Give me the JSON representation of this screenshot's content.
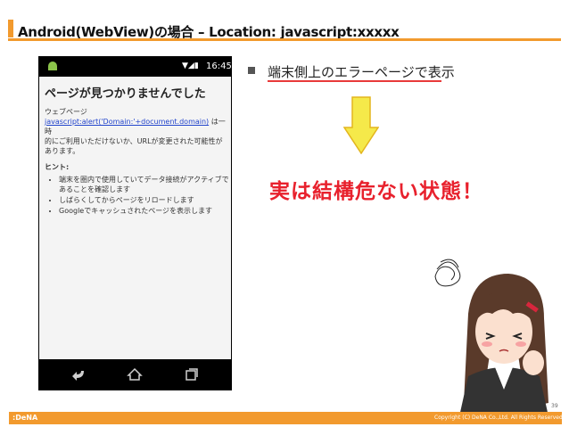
{
  "slide": {
    "title": "Android(WebView)の場合 – Location: javascript:xxxxx",
    "page_number": "39",
    "footer_logo": ":DeNA",
    "copyright": "Copyright (C) DeNA Co.,Ltd. All Rights Reserved."
  },
  "phone": {
    "status_time": "16:45",
    "error_title": "ページが見つかりませんでした",
    "webpage_label": "ウェブページ",
    "webpage_link": "javascript:alert('Domain:'+document.domain)",
    "webpage_msg_tail": " は一時",
    "webpage_msg_rest": "的にご利用いただけないか、URLが変更された可能性があります。",
    "hint_label": "ヒント:",
    "hints": [
      "端末を圏内で使用していてデータ接続がアクティブであることを確認します",
      "しばらくしてからページをリロードします",
      "Googleでキャッシュされたページを表示します"
    ]
  },
  "content": {
    "bullet_text": "端末側上のエラーページで表示",
    "emphasis": "実は結構危ない状態！"
  },
  "colors": {
    "accent": "#f29a2e",
    "emphasis_red": "#e8212d",
    "arrow_fill": "#f5e94a"
  }
}
